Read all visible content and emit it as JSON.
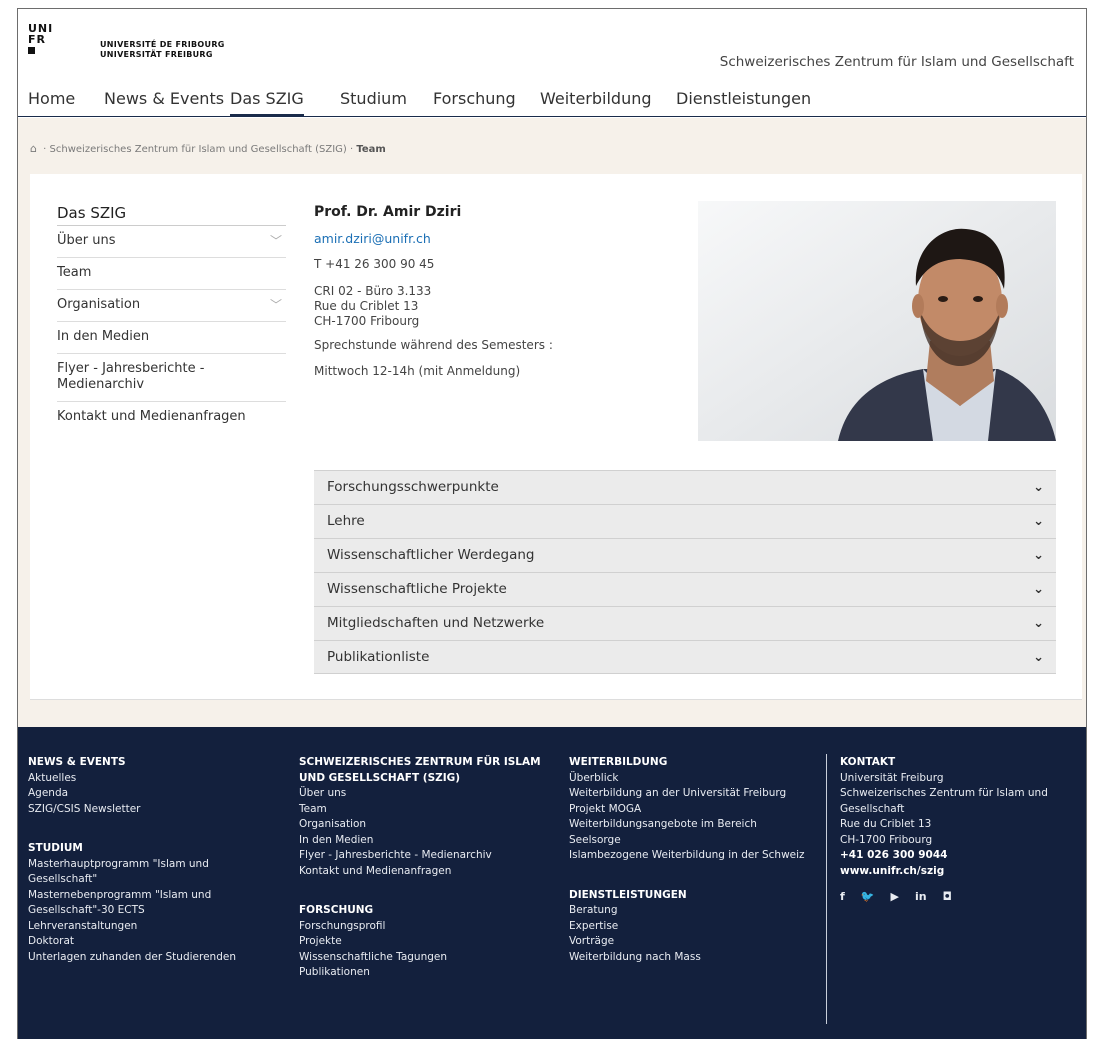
{
  "header": {
    "logo_mark": [
      "UNI",
      "FR"
    ],
    "logo_line1": "UNIVERSITÉ DE FRIBOURG",
    "logo_line2": "UNIVERSITÄT FREIBURG",
    "site_title": "Schweizerisches Zentrum für Islam und Gesellschaft"
  },
  "nav": [
    {
      "label": "Home"
    },
    {
      "label": "News & Events"
    },
    {
      "label": "Das SZIG",
      "active": true
    },
    {
      "label": "Studium"
    },
    {
      "label": "Forschung"
    },
    {
      "label": "Weiterbildung"
    },
    {
      "label": "Dienstleistungen"
    }
  ],
  "breadcrumb": {
    "sep": "·",
    "parent": "Schweizerisches Zentrum für Islam und Gesellschaft (SZIG)",
    "current": "Team"
  },
  "sidebar": {
    "heading": "Das SZIG",
    "items": [
      {
        "label": "Über uns",
        "expandable": true
      },
      {
        "label": "Team"
      },
      {
        "label": "Organisation",
        "expandable": true
      },
      {
        "label": "In den Medien"
      },
      {
        "label": "Flyer - Jahresberichte - Medienarchiv"
      },
      {
        "label": "Kontakt und Medienanfragen"
      }
    ]
  },
  "person": {
    "name": "Prof. Dr. Amir Dziri",
    "email": "amir.dziri@unifr.ch",
    "phone": "T +41 26 300 90 45",
    "office": "CRI 02 - Büro 3.133",
    "street": "Rue du Criblet 13",
    "city": "CH-1700 Fribourg",
    "hours_label": "Sprechstunde während des Semesters :",
    "hours": "Mittwoch 12-14h (mit Anmeldung)"
  },
  "accordion": [
    "Forschungsschwerpunkte",
    "Lehre",
    "Wissenschaftlicher Werdegang",
    "Wissenschaftliche Projekte",
    "Mitgliedschaften und Netzwerke",
    "Publikationliste"
  ],
  "footer": {
    "news_heading": "NEWS & EVENTS",
    "news": [
      "Aktuelles",
      "Agenda",
      "SZIG/CSIS Newsletter"
    ],
    "studium_heading": "STUDIUM",
    "studium": [
      "Masterhauptprogramm \"Islam und Gesellschaft\"",
      "Masternebenprogramm \"Islam und Gesellschaft\"-30 ECTS",
      "Lehrveranstaltungen",
      "Doktorat",
      "Unterlagen zuhanden der Studierenden"
    ],
    "szig_heading": "SCHWEIZERISCHES ZENTRUM FÜR ISLAM UND GESELLSCHAFT (SZIG)",
    "szig": [
      "Über uns",
      "Team",
      "Organisation",
      "In den Medien",
      "Flyer - Jahresberichte - Medienarchiv",
      "Kontakt und Medienanfragen"
    ],
    "forschung_heading": "FORSCHUNG",
    "forschung": [
      "Forschungsprofil",
      "Projekte",
      "Wissenschaftliche Tagungen",
      "Publikationen"
    ],
    "weiterbildung_heading": "WEITERBILDUNG",
    "weiterbildung": [
      "Überblick",
      "Weiterbildung an der Universität Freiburg",
      "Projekt MOGA",
      "Weiterbildungsangebote im Bereich Seelsorge",
      "Islambezogene Weiterbildung in der Schweiz"
    ],
    "dienst_heading": "DIENSTLEISTUNGEN",
    "dienst": [
      "Beratung",
      "Expertise",
      "Vorträge",
      "Weiterbildung nach Mass"
    ],
    "kontakt_heading": "KONTAKT",
    "kontakt": [
      "Universität Freiburg",
      "Schweizerisches Zentrum für Islam und Gesellschaft",
      "Rue du Criblet 13",
      "CH-1700 Fribourg"
    ],
    "kontakt_phone": "+41 026 300 9044",
    "kontakt_web": "www.unifr.ch/szig",
    "social": [
      "f",
      "🐦",
      "▶",
      "in",
      "◘"
    ]
  },
  "colors": {
    "footer_bg": "#13203d",
    "cream": "#f6f1ea",
    "link": "#1b6fb5"
  }
}
